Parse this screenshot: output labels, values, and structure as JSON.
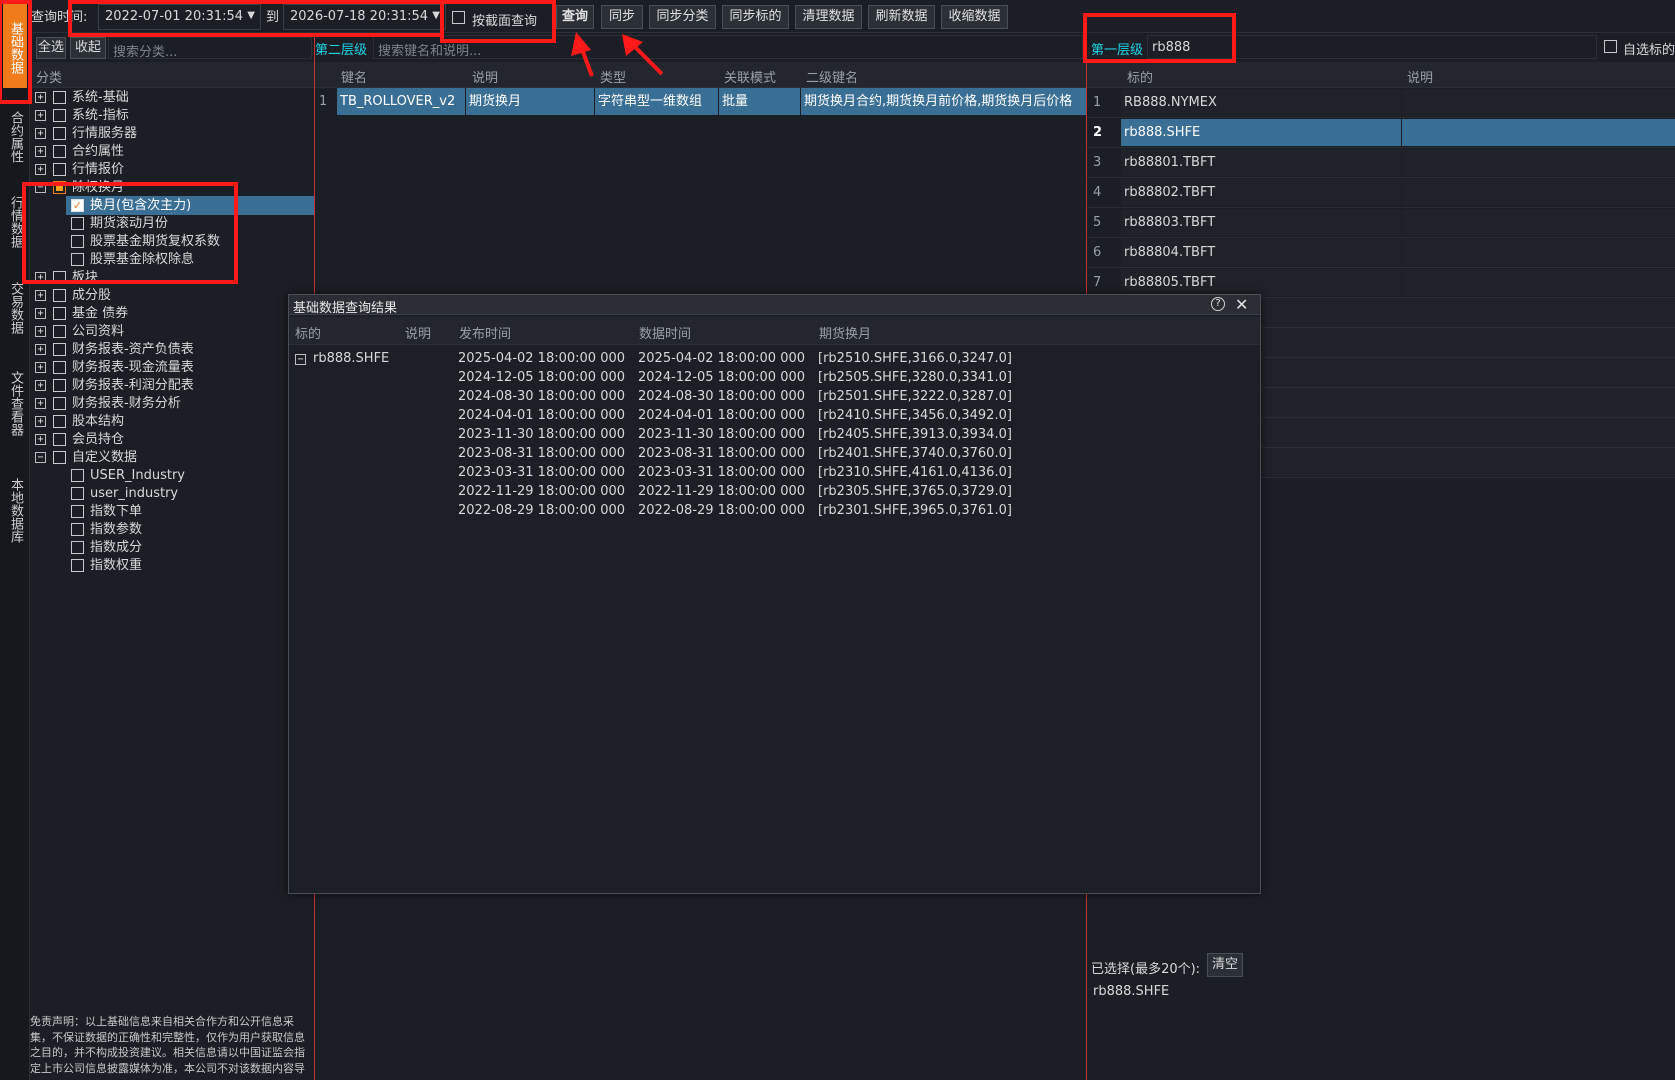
{
  "vertical_sidebar": {
    "items": [
      "基础数据",
      "合约属性",
      "行情数据",
      "交易数据",
      "文件查看器",
      "本地数据库"
    ]
  },
  "toolbar": {
    "query_time_label": "查询时间:",
    "start_datetime": "2022-07-01 20:31:54",
    "to_label": "到",
    "end_datetime": "2026-07-18 20:31:54",
    "snapshot_query_label": "按截面查询",
    "buttons": [
      "查询",
      "同步",
      "同步分类",
      "同步标的",
      "清理数据",
      "刷新数据",
      "收缩数据"
    ]
  },
  "left_panel": {
    "select_all": "全选",
    "collapse": "收起",
    "search_placeholder": "搜索分类...",
    "column_header": "分类",
    "tree": [
      {
        "label": "系统-基础"
      },
      {
        "label": "系统-指标"
      },
      {
        "label": "行情服务器"
      },
      {
        "label": "合约属性"
      },
      {
        "label": "行情报价"
      },
      {
        "label": "除权换月"
      },
      {
        "label": "换月(包含次主力)"
      },
      {
        "label": "期货滚动月份"
      },
      {
        "label": "股票基金期货复权系数"
      },
      {
        "label": "股票基金除权除息"
      },
      {
        "label": "板块"
      },
      {
        "label": "成分股"
      },
      {
        "label": "基金 债券"
      },
      {
        "label": "公司资料"
      },
      {
        "label": "财务报表-资产负债表"
      },
      {
        "label": "财务报表-现金流量表"
      },
      {
        "label": "财务报表-利润分配表"
      },
      {
        "label": "财务报表-财务分析"
      },
      {
        "label": "股本结构"
      },
      {
        "label": "会员持仓"
      },
      {
        "label": "自定义数据"
      },
      {
        "label": "USER_Industry"
      },
      {
        "label": "user_industry"
      },
      {
        "label": "指数下单"
      },
      {
        "label": "指数参数"
      },
      {
        "label": "指数成分"
      },
      {
        "label": "指数权重"
      }
    ],
    "disclaimer": [
      "免责声明：以上基础信息来自相关合作方和公开信息采",
      "集，不保证数据的正确性和完整性，仅作为用户获取信息",
      "之目的，并不构成投资建议。相关信息请以中国证监会指",
      "定上市公司信息披露媒体为准，本公司不对该数据内容导"
    ]
  },
  "middle_panel": {
    "level_label": "第二层级",
    "search_placeholder": "搜索键名和说明...",
    "columns": [
      "键名",
      "说明",
      "类型",
      "关联模式",
      "二级键名"
    ],
    "rows": [
      {
        "num": "1",
        "key": "TB_ROLLOVER_v2",
        "desc": "期货换月",
        "type": "字符串型一维数组",
        "mode": "批量",
        "subkeys": "期货换月合约,期货换月前价格,期货换月后价格"
      }
    ]
  },
  "right_panel": {
    "level_label": "第一层级",
    "search_value": "rb888",
    "custom_label": "自选标的",
    "columns": [
      "标的",
      "说明"
    ],
    "rows": [
      {
        "num": "1",
        "symbol": "RB888.NYMEX"
      },
      {
        "num": "2",
        "symbol": "rb888.SHFE"
      },
      {
        "num": "3",
        "symbol": "rb88801.TBFT"
      },
      {
        "num": "4",
        "symbol": "rb88802.TBFT"
      },
      {
        "num": "5",
        "symbol": "rb88803.TBFT"
      },
      {
        "num": "6",
        "symbol": "rb88804.TBFT"
      },
      {
        "num": "7",
        "symbol": "rb88805.TBFT"
      }
    ],
    "selected_label": "已选择(最多20个):",
    "clear_label": "清空",
    "selected_value": "rb888.SHFE"
  },
  "dialog": {
    "title": "基础数据查询结果",
    "columns": [
      "标的",
      "说明",
      "发布时间",
      "数据时间",
      "期货换月"
    ],
    "symbol": "rb888.SHFE",
    "rows": [
      {
        "publish": "2025-04-02 18:00:00 000",
        "data_time": "2025-04-02 18:00:00 000",
        "rollover": "[rb2510.SHFE,3166.0,3247.0]"
      },
      {
        "publish": "2024-12-05 18:00:00 000",
        "data_time": "2024-12-05 18:00:00 000",
        "rollover": "[rb2505.SHFE,3280.0,3341.0]"
      },
      {
        "publish": "2024-08-30 18:00:00 000",
        "data_time": "2024-08-30 18:00:00 000",
        "rollover": "[rb2501.SHFE,3222.0,3287.0]"
      },
      {
        "publish": "2024-04-01 18:00:00 000",
        "data_time": "2024-04-01 18:00:00 000",
        "rollover": "[rb2410.SHFE,3456.0,3492.0]"
      },
      {
        "publish": "2023-11-30 18:00:00 000",
        "data_time": "2023-11-30 18:00:00 000",
        "rollover": "[rb2405.SHFE,3913.0,3934.0]"
      },
      {
        "publish": "2023-08-31 18:00:00 000",
        "data_time": "2023-08-31 18:00:00 000",
        "rollover": "[rb2401.SHFE,3740.0,3760.0]"
      },
      {
        "publish": "2023-03-31 18:00:00 000",
        "data_time": "2023-03-31 18:00:00 000",
        "rollover": "[rb2310.SHFE,4161.0,4136.0]"
      },
      {
        "publish": "2022-11-29 18:00:00 000",
        "data_time": "2022-11-29 18:00:00 000",
        "rollover": "[rb2305.SHFE,3765.0,3729.0]"
      },
      {
        "publish": "2022-08-29 18:00:00 000",
        "data_time": "2022-08-29 18:00:00 000",
        "rollover": "[rb2301.SHFE,3965.0,3761.0]"
      }
    ]
  },
  "colors": {
    "background": "#1b1e24",
    "highlight": "#3a6f95",
    "accent_orange": "#f07b1a",
    "annotation_red": "#ff1a1a",
    "level_label": "#1fd6e6"
  }
}
